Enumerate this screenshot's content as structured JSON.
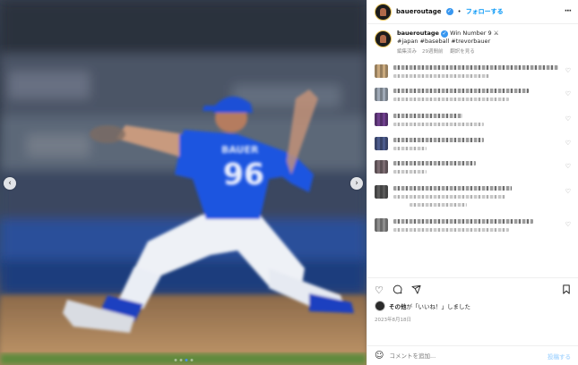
{
  "photo": {
    "jersey_name": "BAUER",
    "jersey_number": "96",
    "slide_count": 4,
    "active_slide": 2
  },
  "header": {
    "username": "baueroutage",
    "follow_label": "フォローする",
    "more_icon": "ellipsis-icon",
    "verified_icon": "check"
  },
  "caption": {
    "username": "baueroutage",
    "text": "Win Number 9 ⚔",
    "hashtags": "#japan #baseball #trevorbauer",
    "edited": "編集済み",
    "age": "29週間前",
    "translate": "翻訳を見る"
  },
  "comments": [
    {
      "lines": [
        1,
        0.58
      ]
    },
    {
      "lines": [
        0.82,
        0.7
      ]
    },
    {
      "lines": [
        0.42,
        0.55
      ]
    },
    {
      "lines": [
        0.55,
        0.2
      ]
    },
    {
      "lines": [
        0.5,
        0.2
      ]
    },
    {
      "lines": [
        0.72,
        0.68,
        0.35
      ]
    },
    {
      "lines": [
        0.85,
        0.7
      ]
    }
  ],
  "actions": {
    "like_icon": "heart-icon",
    "comment_icon": "comment-icon",
    "share_icon": "share-icon",
    "save_icon": "bookmark-icon"
  },
  "likes": {
    "who": "その他",
    "text": "が「いいね！」しました"
  },
  "post_date": "2023年8月18日",
  "add_comment": {
    "placeholder": "コメントを追加...",
    "post_label": "投稿する"
  }
}
